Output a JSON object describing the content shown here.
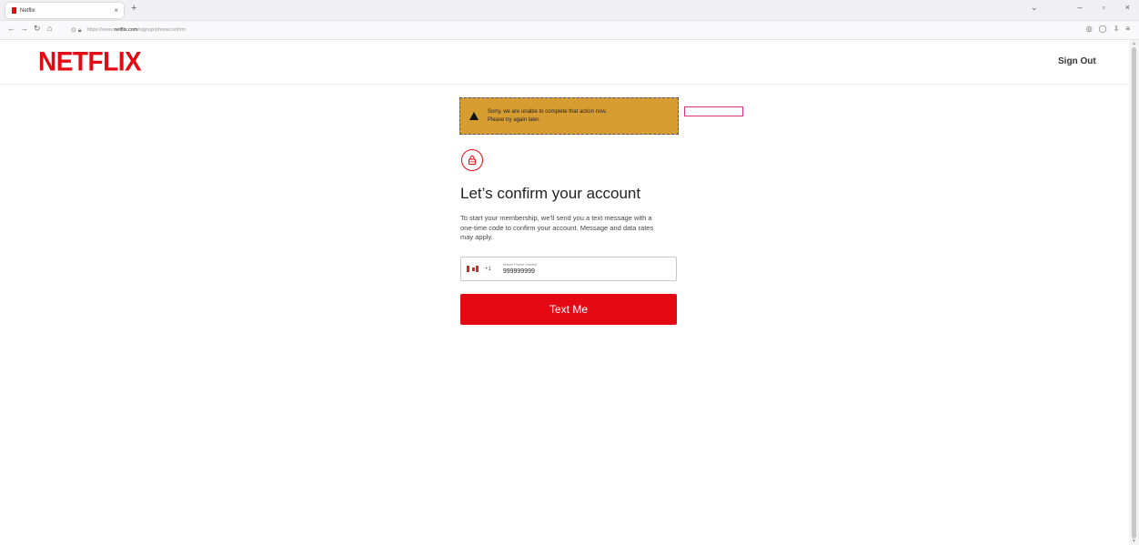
{
  "browser": {
    "tab_title": "Netflix",
    "tab_close": "×",
    "new_tab": "+",
    "url_prefix": "https://www.",
    "url_domain": "netflix.com",
    "url_path": "/signup/phoneconfirm"
  },
  "header": {
    "logo": "NETFLIX",
    "sign_out": "Sign Out"
  },
  "alert": {
    "message_line1": "Sorry, we are unable to complete that action now.",
    "message_line2": "Please try again later."
  },
  "main": {
    "heading": "Let’s confirm your account",
    "description": "To start your membership, we’ll send you a text message with a one-time code to confirm your account. Message and data rates may apply.",
    "phone": {
      "country_code": "+1",
      "label": "Mobile Phone Number",
      "value": "999999999"
    },
    "submit_label": "Text Me"
  },
  "colors": {
    "brand": "#e50914",
    "alert_bg": "#d89d31"
  },
  "icons": [
    "lock-icon",
    "warning-icon",
    "canada-flag-icon"
  ]
}
